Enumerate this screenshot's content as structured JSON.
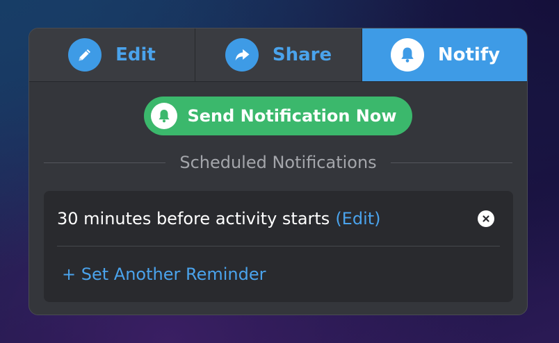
{
  "tabs": [
    {
      "label": "Edit",
      "icon": "pencil-icon",
      "active": false
    },
    {
      "label": "Share",
      "icon": "share-arrow-icon",
      "active": false
    },
    {
      "label": "Notify",
      "icon": "bell-icon",
      "active": true
    }
  ],
  "send_button": {
    "label": "Send Notification Now",
    "icon": "bell-icon"
  },
  "section_heading": "Scheduled Notifications",
  "scheduled": [
    {
      "text": "30 minutes before activity starts",
      "edit_label": "(Edit)",
      "remove_icon": "close-circle-icon"
    }
  ],
  "add_reminder_label": "+ Set Another Reminder",
  "colors": {
    "accent_blue": "#3e9be6",
    "send_green": "#3bb86c",
    "panel_bg": "#34363b",
    "list_bg": "#292a2e"
  }
}
